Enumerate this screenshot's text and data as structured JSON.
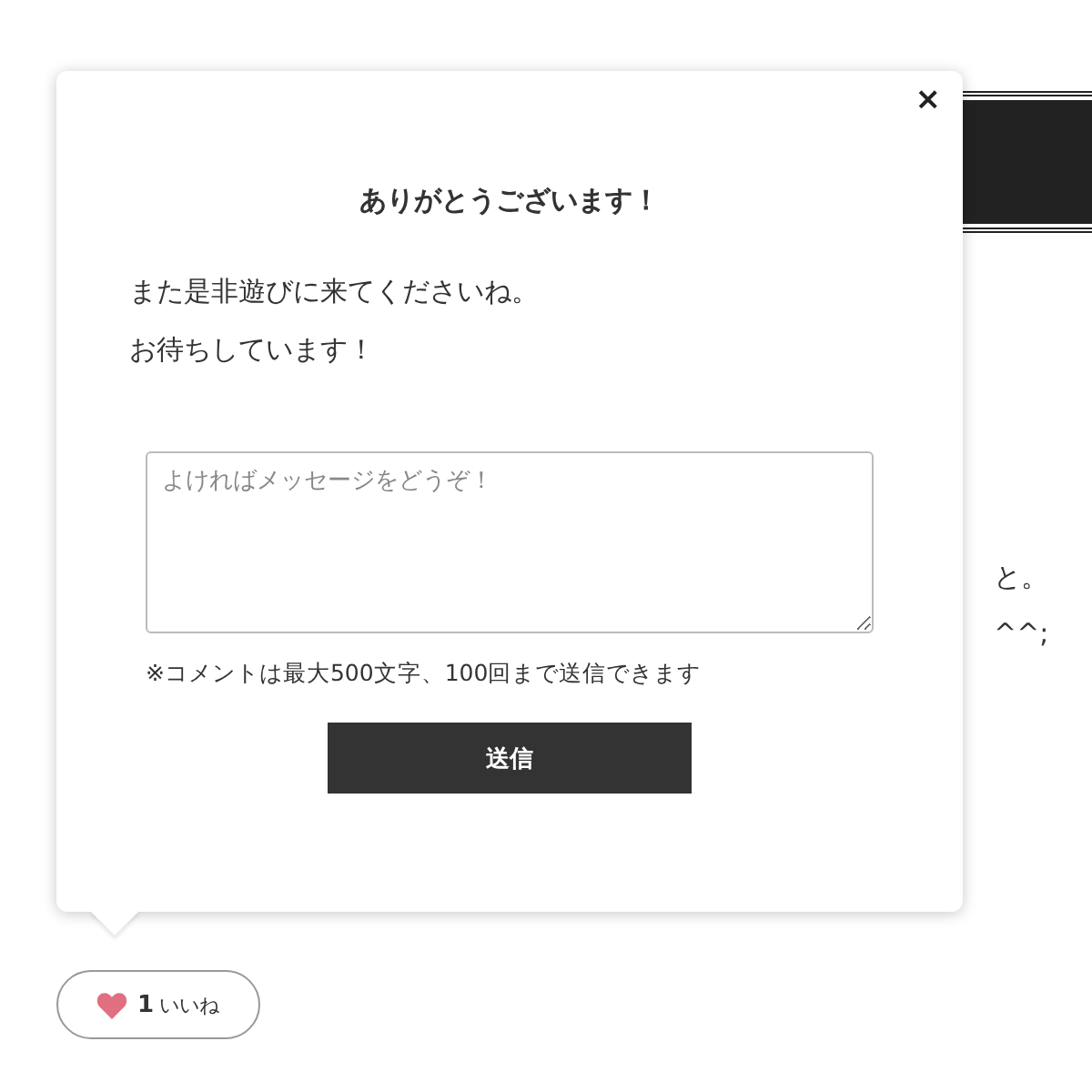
{
  "background": {
    "fragments": [
      "と。",
      "^^;"
    ]
  },
  "dialog": {
    "close": "×",
    "title": "ありがとうございます！",
    "message": [
      "また是非遊びに来てくださいね。",
      "お待ちしています！"
    ],
    "comment": {
      "placeholder": "よければメッセージをどうぞ！"
    },
    "note": "※コメントは最大500文字、100回まで送信できます",
    "submit": "送信"
  },
  "like": {
    "count": "1",
    "label": "いいね"
  }
}
